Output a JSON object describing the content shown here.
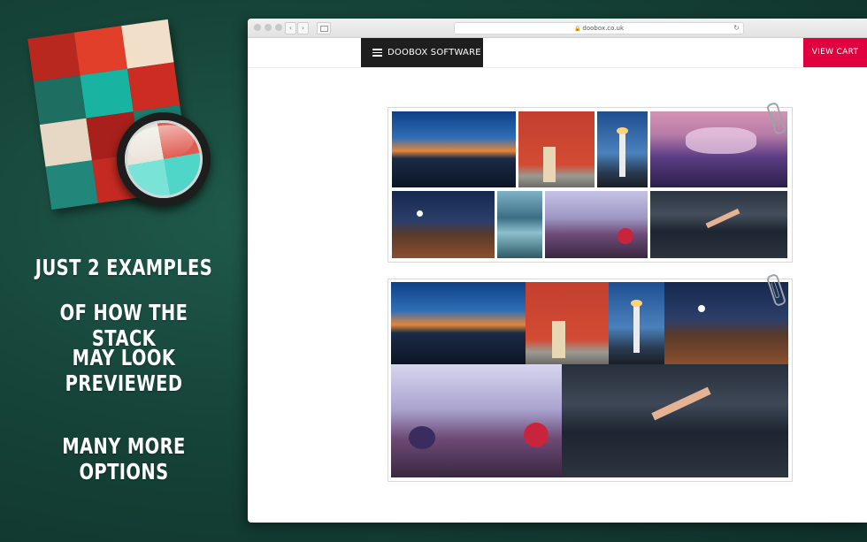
{
  "promo": {
    "lines": [
      "JUST 2 EXAMPLES",
      "OF HOW THE STACK",
      "MAY LOOK PREVIEWED"
    ],
    "more": "MANY MORE OPTIONS"
  },
  "browser": {
    "url": "doobox.co.uk"
  },
  "site": {
    "brand": "DOOBOX SOFTWARE",
    "cart": "VIEW CART"
  },
  "icons": {
    "app": "stack-grid-magnifier-icon",
    "menu": "hamburger-icon",
    "lock": "lock-icon",
    "reload": "reload-icon",
    "clip": "paperclip-icon"
  },
  "colors": {
    "background": "#164438",
    "cart": "#e10040",
    "brand": "#1e1e1e"
  },
  "galleries": [
    {
      "style": "justified-rows",
      "photos": [
        "city-skyline-dusk",
        "red-door-bicycle",
        "lighthouse-night",
        "purple-cloud-sunset",
        "moon-rock-landscape",
        "mountain-lake",
        "frozen-berries",
        "swimmer-lake"
      ]
    },
    {
      "style": "mosaic",
      "photos": [
        "city-skyline-dusk",
        "red-door-bicycle",
        "lighthouse-night",
        "moon-rock-landscape",
        "frozen-berries",
        "swimmer-lake"
      ]
    }
  ]
}
